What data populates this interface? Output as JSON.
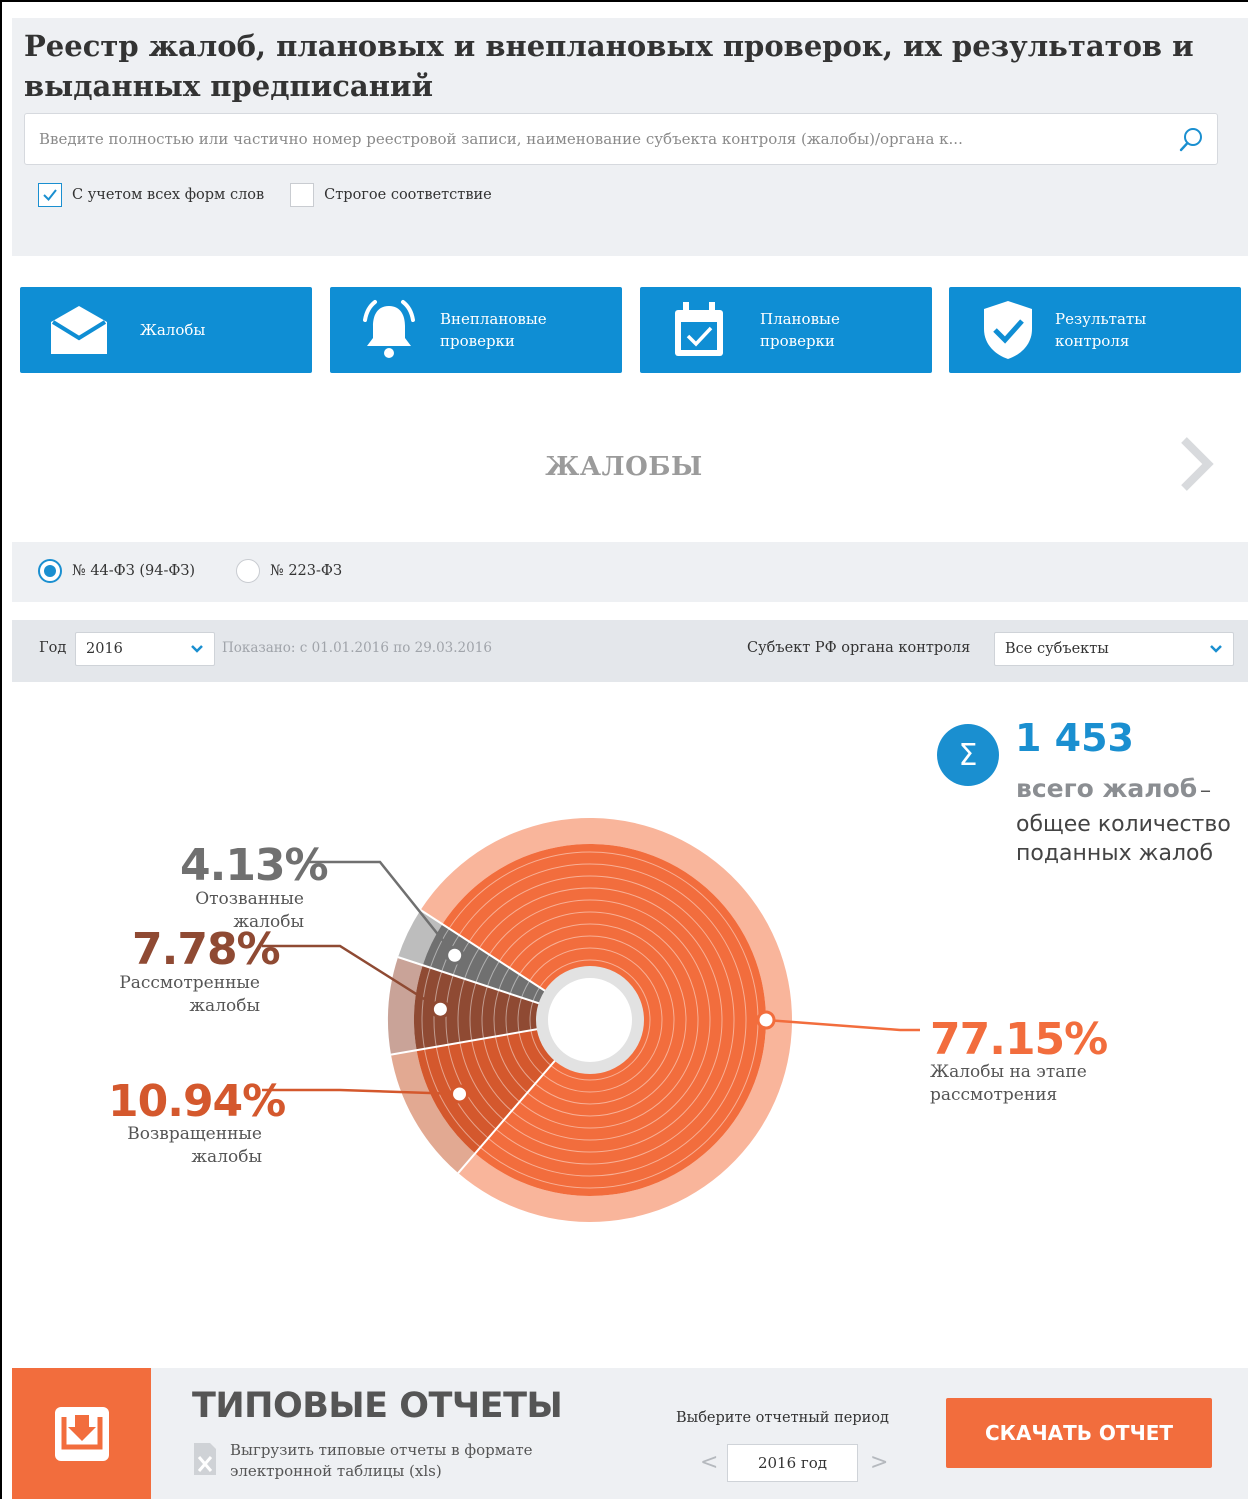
{
  "page_title": "Реестр жалоб, плановых и внеплановых проверок, их результатов и выданных предписаний",
  "search": {
    "placeholder": "Введите полностью или частично номер реестровой записи, наименование субъекта контроля (жалобы)/органа к...",
    "icon": "search-icon"
  },
  "search_options": [
    {
      "label": "С учетом всех форм слов",
      "checked": true
    },
    {
      "label": "Строгое соответствие",
      "checked": false
    }
  ],
  "categories": [
    {
      "label": "Жалобы",
      "icon": "envelope-icon"
    },
    {
      "label": "Внеплановые проверки",
      "icon": "bell-icon"
    },
    {
      "label": "Плановые проверки",
      "icon": "calendar-check-icon"
    },
    {
      "label": "Результаты контроля",
      "icon": "shield-check-icon"
    }
  ],
  "section_title": "ЖАЛОБЫ",
  "law_options": [
    {
      "label": "№ 44-ФЗ (94-ФЗ)",
      "selected": true
    },
    {
      "label": "№ 223-ФЗ",
      "selected": false
    }
  ],
  "filters": {
    "year_label": "Год",
    "year_value": "2016",
    "shown_note": "Показано: с 01.01.2016 по 29.03.2016",
    "subject_label": "Субъект РФ органа контроля",
    "subject_value": "Все субъекты"
  },
  "total": {
    "value": "1 453",
    "label": "всего жалоб",
    "dash": "–",
    "description": "общее количество поданных жалоб"
  },
  "chart_data": {
    "type": "pie",
    "total": 1453,
    "slices": [
      {
        "value_label": "77.15%",
        "value": 77.15,
        "label": "Жалобы на этапе рассмотрения",
        "color": "#f26d3d",
        "outer_color": "#f9b59b"
      },
      {
        "value_label": "10.94%",
        "value": 10.94,
        "label": "Возвращенные жалобы",
        "color": "#d4582d",
        "outer_color": "#e2a992"
      },
      {
        "value_label": "7.78%",
        "value": 7.78,
        "label": "Рассмотренные жалобы",
        "color": "#8f4a33",
        "outer_color": "#c9a398"
      },
      {
        "value_label": "4.13%",
        "value": 4.13,
        "label": "Отозванные жалобы",
        "color": "#707070",
        "outer_color": "#bdbdbd"
      }
    ]
  },
  "reports": {
    "title": "ТИПОВЫЕ ОТЧЕТЫ",
    "subtitle": "Выгрузить типовые отчеты в формате электронной таблицы (xls)",
    "period_label": "Выберите отчетный период",
    "period_value": "2016 год",
    "prev": "<",
    "next": ">",
    "download_label": "СКАЧАТЬ ОТЧЕТ"
  },
  "colors": {
    "accent_blue": "#0f8ed4",
    "accent_orange": "#f26d3d"
  }
}
